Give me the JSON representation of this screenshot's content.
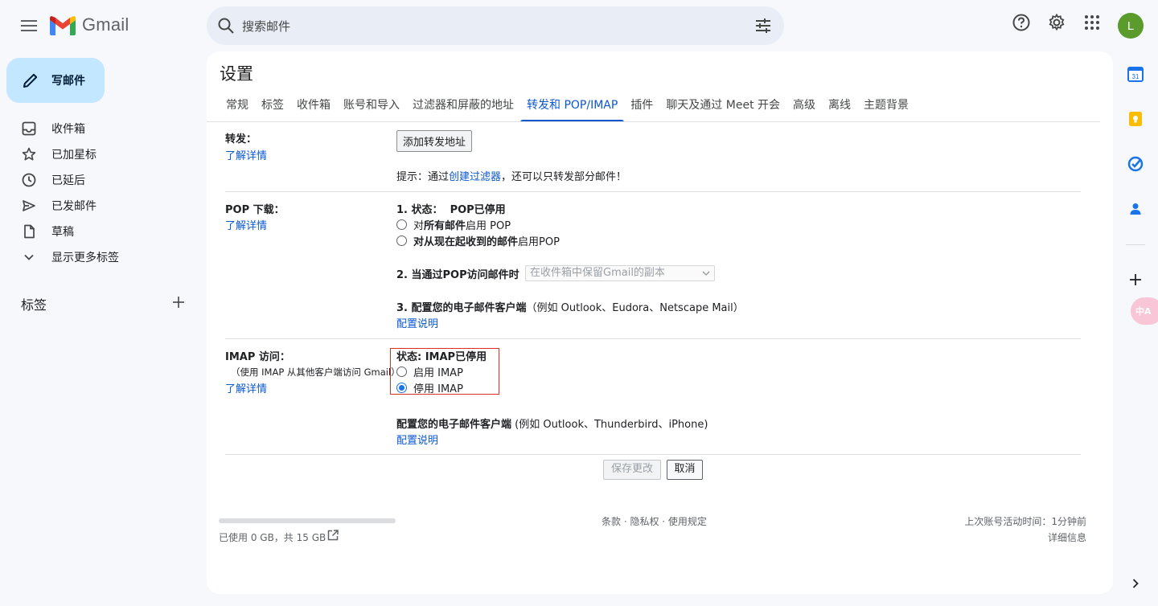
{
  "app": {
    "name": "Gmail",
    "avatar_letter": "L"
  },
  "search": {
    "placeholder": "搜索邮件"
  },
  "compose": {
    "label": "写邮件"
  },
  "nav": {
    "items": [
      {
        "label": "收件箱",
        "icon": "inbox-icon"
      },
      {
        "label": "已加星标",
        "icon": "star-icon"
      },
      {
        "label": "已延后",
        "icon": "clock-icon"
      },
      {
        "label": "已发邮件",
        "icon": "send-icon"
      },
      {
        "label": "草稿",
        "icon": "draft-icon"
      },
      {
        "label": "显示更多标签",
        "icon": "chevron-down-icon"
      }
    ],
    "labels_heading": "标签"
  },
  "settings": {
    "title": "设置",
    "tabs": [
      "常规",
      "标签",
      "收件箱",
      "账号和导入",
      "过滤器和屏蔽的地址",
      "转发和 POP/IMAP",
      "插件",
      "聊天及通过 Meet 开会",
      "高级",
      "离线",
      "主题背景"
    ],
    "active_tab": "转发和 POP/IMAP",
    "forwarding": {
      "label": "转发：",
      "learn_more": "了解详情",
      "add_button": "添加转发地址",
      "tip_prefix": "提示：通过",
      "tip_link": "创建过滤器",
      "tip_suffix": "，还可以只转发部分邮件！"
    },
    "pop": {
      "label": "POP 下载：",
      "learn_more": "了解详情",
      "status_label": "1. 状态：",
      "status_value": "POP已停用",
      "option_all_prefix": "对",
      "option_all_bold": "所有邮件",
      "option_all_suffix": "启用 POP",
      "option_now_bold": "对从现在起收到的邮件",
      "option_now_suffix": "启用POP",
      "access_label": "2. 当通过POP访问邮件时",
      "access_select": "在收件箱中保留Gmail的副本",
      "config_label": "3. 配置您的电子邮件客户端",
      "config_examples": "（例如 Outlook、Eudora、Netscape Mail）",
      "config_link": "配置说明"
    },
    "imap": {
      "label": "IMAP 访问：",
      "sublabel": "（使用 IMAP 从其他客户端访问 Gmail）",
      "learn_more": "了解详情",
      "status": "状态: IMAP已停用",
      "enable_option": "启用 IMAP",
      "disable_option": "停用 IMAP",
      "selected": "停用 IMAP",
      "config_label": "配置您的电子邮件客户端",
      "config_examples": " (例如 Outlook、Thunderbird、iPhone)",
      "config_link": "配置说明"
    },
    "save_button": "保存更改",
    "cancel_button": "取消"
  },
  "footer": {
    "storage_used": "已使用 0 GB，共 15 GB",
    "storage_fraction": 0,
    "links": "条款 · 隐私权 · 使用规定",
    "last_activity": "上次账号活动时间：1分钟前",
    "details": "详细信息"
  },
  "side_panel": {
    "calendar_day": "31",
    "translate_badge": "中A"
  },
  "colors": {
    "accent": "#0b57d0",
    "compose_bg": "#c2e7ff",
    "avatar_bg": "#5a9b2c",
    "highlight_border": "#d93025"
  }
}
